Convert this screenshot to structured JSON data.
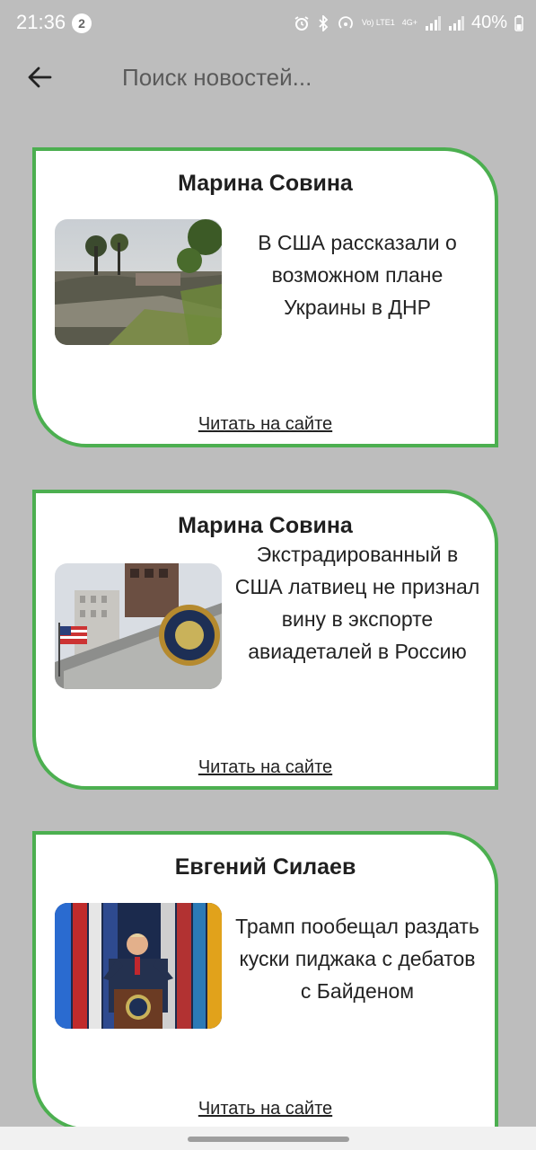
{
  "status_bar": {
    "time": "21:36",
    "notification_count": "2",
    "network_label": "Vo) LTE1",
    "network_type": "4G+",
    "battery": "40%"
  },
  "search": {
    "placeholder": "Поиск новостей..."
  },
  "articles": [
    {
      "author": "Марина Совина",
      "title": "В США рассказали о возможном плане Украины в ДНР",
      "link_label": "Читать на сайте",
      "image_icon": "war-landscape-photo"
    },
    {
      "author": "Марина Совина",
      "title": "Экстрадированный в США латвиец не признал вину в экспорте авиадеталей в Россию",
      "link_label": "Читать на сайте",
      "image_icon": "government-building-photo"
    },
    {
      "author": "Евгений Силаев",
      "title": "Трамп пообещал раздать куски пиджака с дебатов с Байденом",
      "link_label": "Читать на сайте",
      "image_icon": "speaker-at-podium-photo"
    }
  ],
  "colors": {
    "background": "#bdbdbd",
    "card_border": "#4caf50",
    "card_background": "#ffffff"
  }
}
